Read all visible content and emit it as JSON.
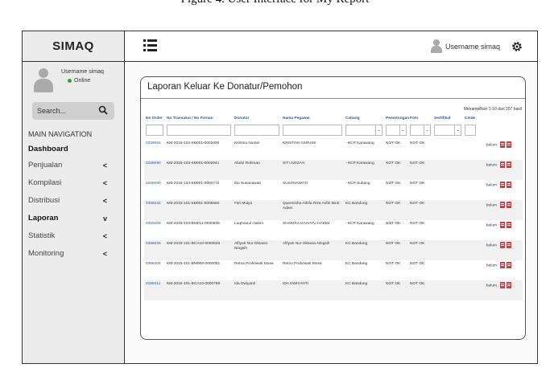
{
  "caption": "Figure 4. User Interface for My Report",
  "app": {
    "brand": "SIMAQ"
  },
  "user": {
    "name": "Username simaq",
    "status": "Online"
  },
  "search": {
    "placeholder": "Search..."
  },
  "nav": {
    "title": "MAIN NAVIGATION",
    "items": [
      {
        "label": "Dashboard",
        "arrow": "",
        "bold": true
      },
      {
        "label": "Penjualan",
        "arrow": "<",
        "bold": false
      },
      {
        "label": "Kompilasi",
        "arrow": "<",
        "bold": false
      },
      {
        "label": "Distribusi",
        "arrow": "<",
        "bold": false
      },
      {
        "label": "Laporan",
        "arrow": "v",
        "bold": true
      },
      {
        "label": "Statistik",
        "arrow": "<",
        "bold": false
      },
      {
        "label": "Monitoring",
        "arrow": "<",
        "bold": false
      }
    ]
  },
  "topbar": {
    "username": "Username simaq"
  },
  "card": {
    "title": "Laporan Keluar Ke Donatur/Pemohon",
    "showing": "Menampilkan 1-10 dari 207 hasil",
    "columns": [
      "No Order",
      "No Transaksi / No Firman",
      "Donatur",
      "Nama Pegawai",
      "Cabang",
      "Pemotongan",
      "Foto",
      "Sertifikat",
      "Cetak"
    ],
    "rows": [
      {
        "order": "0258081",
        "trans": "KM-2015-103-KB001-0002690",
        "donatur": "Kristina Nurani",
        "nama": "KRISTINA NURANI",
        "cabang": "- KCP Karawang",
        "pot": "NOT OK",
        "foto": "NOT OK",
        "cetak": "belum"
      },
      {
        "order": "0258090",
        "trans": "KM-2015-103-KB001-0002041",
        "donatur": "Abdul Rohman",
        "nama": "SITI AZIZAH",
        "cabang": "- KCP Karawang",
        "pot": "NOT OK",
        "foto": "NOT OK",
        "cetak": "belum"
      },
      {
        "order": "0258090",
        "trans": "KM-2015-104-KB001-0000772",
        "donatur": "Ibu Susanawati",
        "nama": "SUSANAWATI",
        "cabang": "- KCP Subang",
        "pot": "NOT OK",
        "foto": "NOT OK",
        "cetak": "belum"
      },
      {
        "order": "0358232",
        "trans": "KM-2015-101-KB001-0005550",
        "donatur": "Fitri Mulya",
        "nama": "Queenisha Athifa Riza Arifin Binti Adam",
        "cabang": "KC Bandung",
        "pot": "NOT OK",
        "foto": "NOT OK",
        "cetak": "belum"
      },
      {
        "order": "0359208",
        "trans": "KM-2015-103-BM011-0000605",
        "donatur": "Luqmanul Hakim",
        "nama": "SHAKIRA DAHAYU HAKIM",
        "cabang": "- KCP Karawang",
        "pot": "NOT OK",
        "foto": "NOT OK",
        "cetak": "belum"
      },
      {
        "order": "0358225",
        "trans": "KM-2015-101-BCA10-0000826",
        "donatur": "Alfiyah Nur Oktavia Ningsih",
        "nama": "Alfiyah Nur Oktavia Ningsih",
        "cabang": "KC Bandung",
        "pot": "NOT OK",
        "foto": "NOT OK",
        "cetak": "belum"
      },
      {
        "order": "0358404",
        "trans": "KM-2015-101-BM008-0000051",
        "donatur": "Retna Probowati Musa",
        "nama": "Retno Probowati Musa",
        "cabang": "KC Bandung",
        "pot": "NOT OK",
        "foto": "NOT OK",
        "cetak": "belum"
      },
      {
        "order": "0258411",
        "trans": "KM-2015-101-BCA10-0000798",
        "donatur": "Ida Dwiyanti",
        "nama": "IDA DWIYANTI",
        "cabang": "KC Bandung",
        "pot": "NOT OK",
        "foto": "NOT OK",
        "cetak": "belum"
      }
    ]
  },
  "colors": {
    "link": "#2a5aa0",
    "sidebar": "#ececec",
    "online": "#3c9c3c",
    "pdf": "#d43d3d"
  }
}
